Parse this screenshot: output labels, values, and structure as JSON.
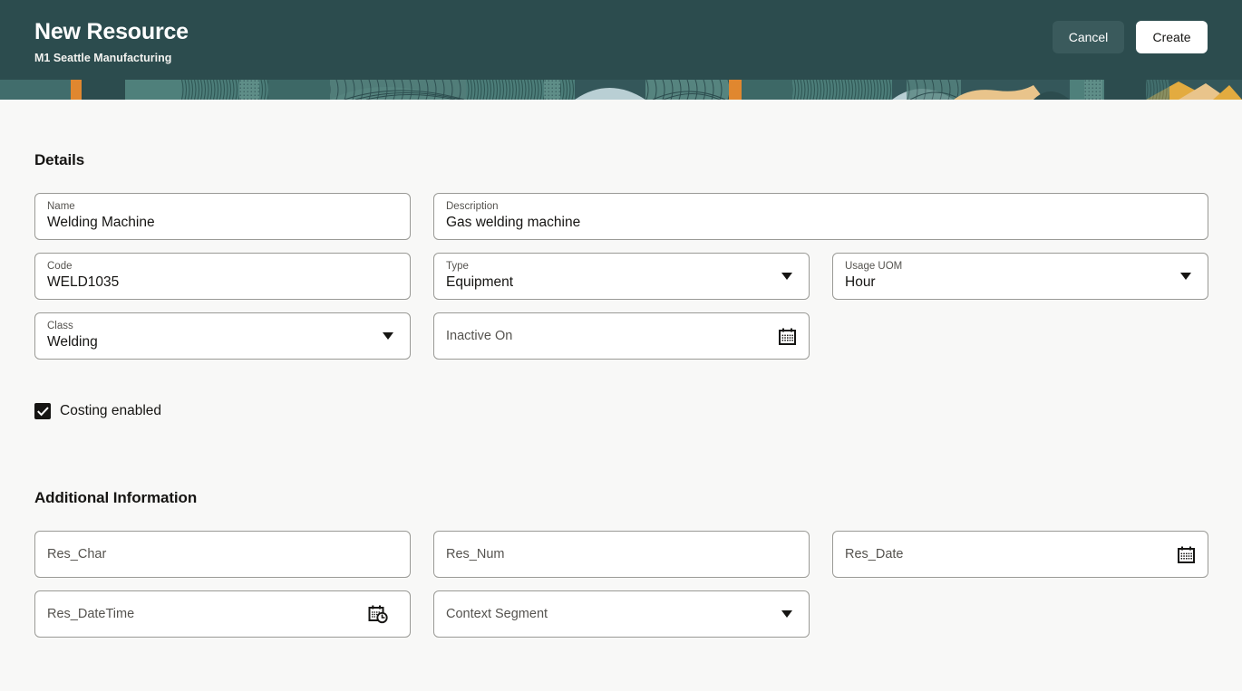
{
  "header": {
    "title": "New Resource",
    "subtitle": "M1 Seattle Manufacturing",
    "cancel_label": "Cancel",
    "create_label": "Create",
    "background_color": "#2c4c4e",
    "cancel_background_color": "#3a5a5c",
    "create_background_color": "#ffffff"
  },
  "banner": {
    "name": "decorative-pattern-banner",
    "colors": {
      "base": "#34575a",
      "dark_teal": "#2c4c4e",
      "mid_teal": "#416d6c",
      "light_teal": "#6f9a94",
      "pale_blue": "#b9cfd4",
      "sand": "#e9c48b",
      "orange": "#e0872f",
      "amber": "#e3ab3f"
    }
  },
  "details": {
    "title": "Details",
    "fields": [
      {
        "name": "name",
        "label": "Name",
        "value": "Welding Machine",
        "control": "text",
        "empty": false
      },
      {
        "name": "description",
        "label": "Description",
        "value": "Gas welding machine",
        "control": "text",
        "empty": false,
        "span": 2
      },
      {
        "name": "code",
        "label": "Code",
        "value": "WELD1035",
        "control": "text",
        "empty": false
      },
      {
        "name": "type",
        "label": "Type",
        "value": "Equipment",
        "control": "select",
        "empty": false
      },
      {
        "name": "usage-uom",
        "label": "Usage UOM",
        "value": "Hour",
        "control": "select",
        "empty": false
      },
      {
        "name": "class",
        "label": "Class",
        "value": "Welding",
        "control": "select",
        "empty": false
      },
      {
        "name": "inactive-on",
        "label": "Inactive On",
        "value": "",
        "control": "date",
        "empty": true
      }
    ],
    "checkbox": {
      "label": "Costing enabled",
      "checked": true
    }
  },
  "additional": {
    "title": "Additional Information",
    "fields": [
      {
        "name": "res-char",
        "label": "Res_Char",
        "value": "",
        "control": "text",
        "empty": true
      },
      {
        "name": "res-num",
        "label": "Res_Num",
        "value": "",
        "control": "text",
        "empty": true
      },
      {
        "name": "res-date",
        "label": "Res_Date",
        "value": "",
        "control": "date",
        "empty": true
      },
      {
        "name": "res-datetime",
        "label": "Res_DateTime",
        "value": "",
        "control": "datetime",
        "empty": true
      },
      {
        "name": "context-segment",
        "label": "Context Segment",
        "value": "",
        "control": "select",
        "empty": true
      }
    ]
  },
  "icons": {
    "calendar": "calendar-icon",
    "calendar_clock": "calendar-clock-icon",
    "caret": "chevron-down-icon",
    "check": "check-icon"
  }
}
